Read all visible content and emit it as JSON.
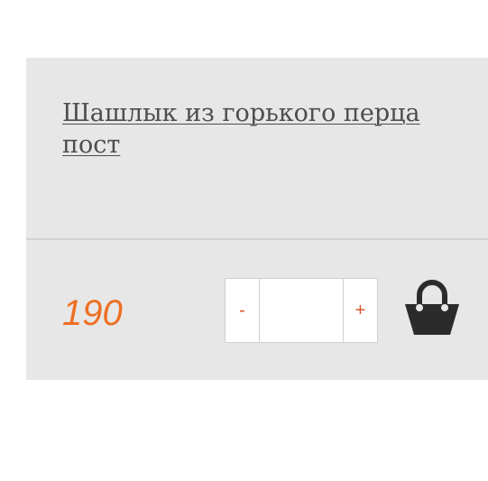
{
  "product": {
    "title": "Шашлык из горького перца пост",
    "price": "190"
  },
  "quantity": {
    "minus_label": "-",
    "plus_label": "+",
    "value": ""
  },
  "icons": {
    "basket": "basket-icon"
  },
  "colors": {
    "card_background": "#e7e7e7",
    "price": "#ee6f24",
    "stepper_sign": "#d9542a",
    "title": "#4d4d4d",
    "basket_icon": "#2b2b2b"
  }
}
